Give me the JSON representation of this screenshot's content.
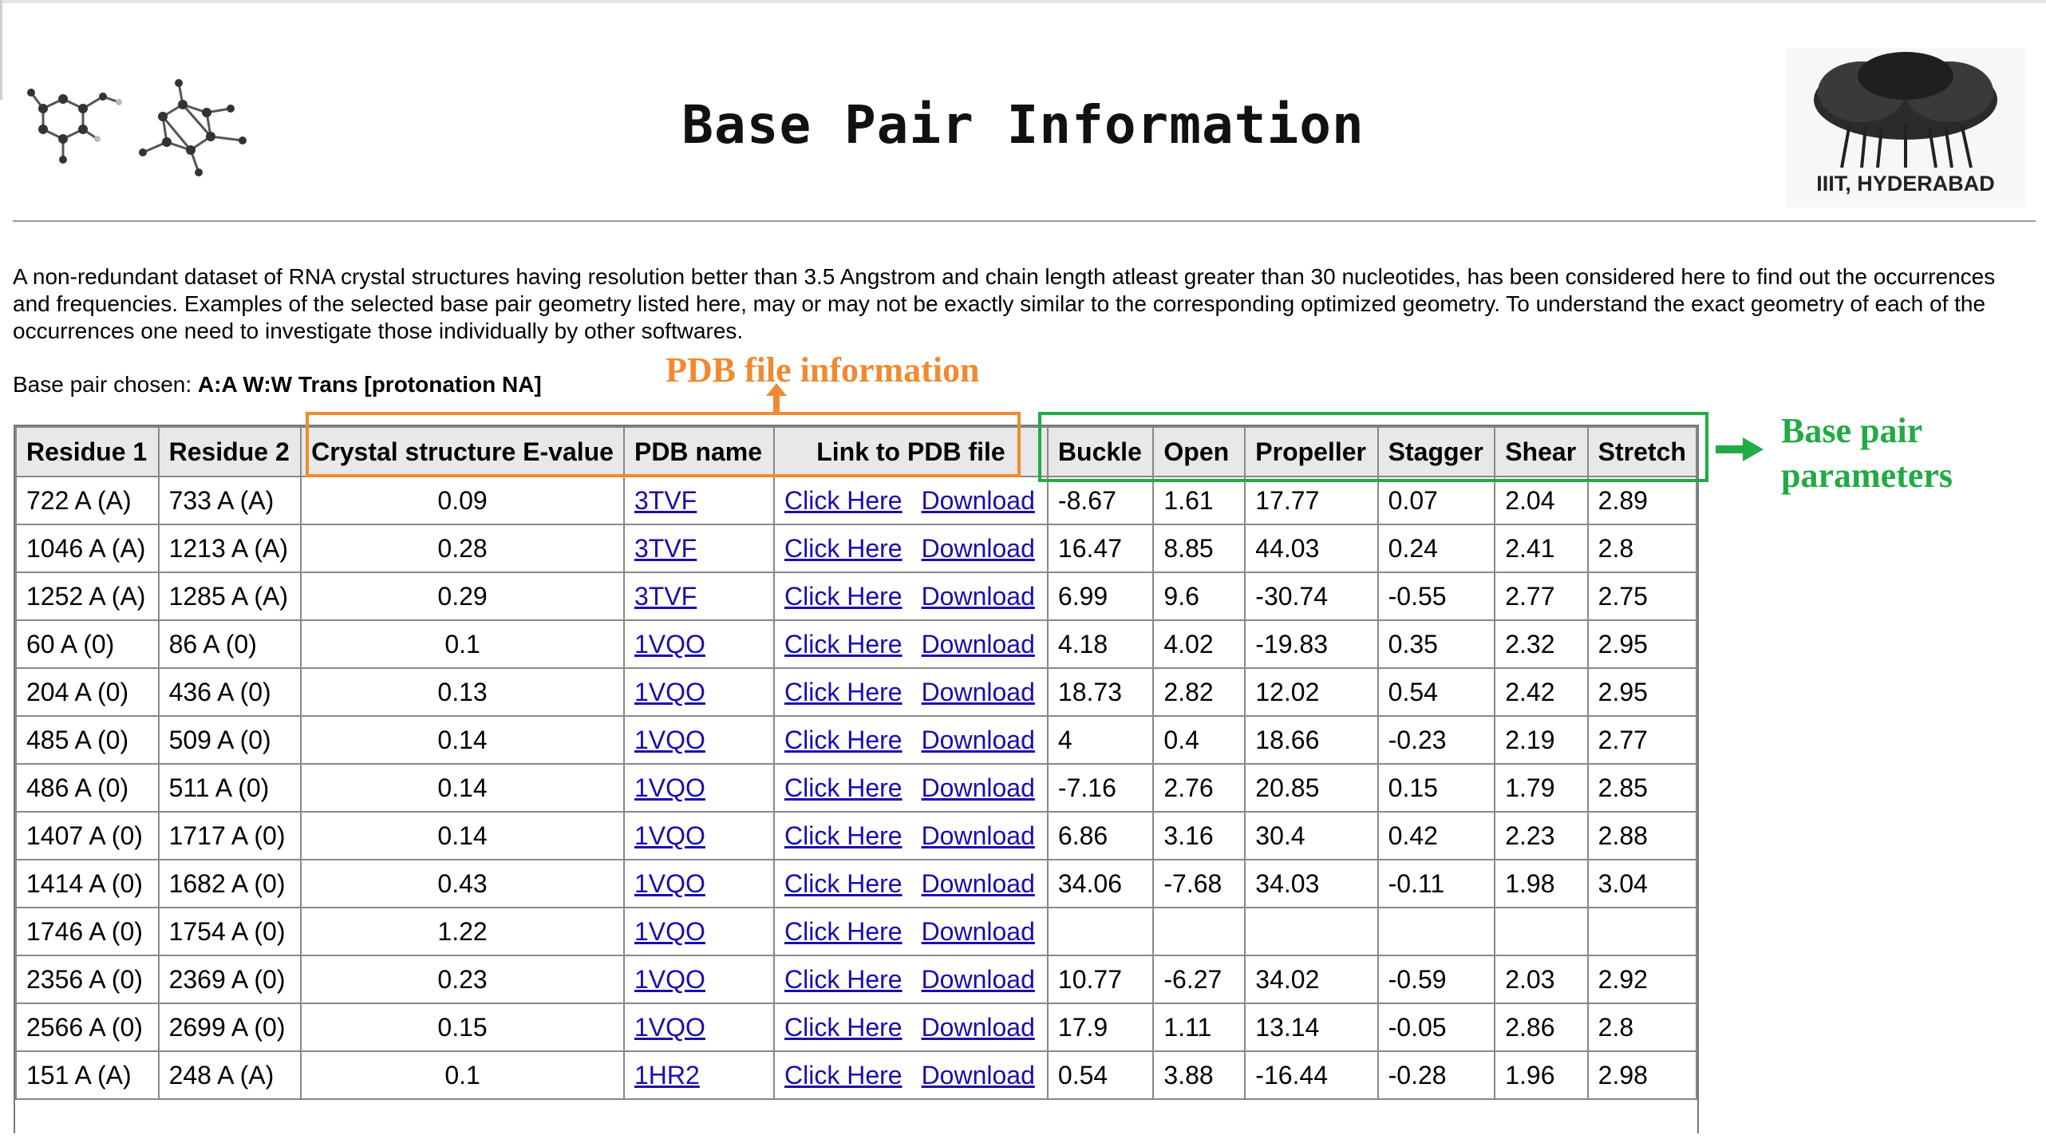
{
  "header": {
    "title": "Base Pair Information",
    "logo_text": "IIIT, HYDERABAD"
  },
  "intro": "A non-redundant dataset of RNA crystal structures having resolution better than 3.5 Angstrom and chain length atleast greater than 30 nucleotides, has been considered here to find out the occurrences and frequencies. Examples of the selected base pair geometry listed here, may or may not be exactly similar to the corresponding optimized geometry. To understand the exact geometry of each of the occurrences one need to investigate those individually by other softwares.",
  "chosen": {
    "label": "Base pair chosen:",
    "value": "A:A W:W Trans [protonation NA]"
  },
  "annotations": {
    "pdb_info": "PDB file information",
    "base_params": "Base pair parameters",
    "colors": {
      "orange": "#f08a30",
      "green": "#22aa44"
    }
  },
  "table": {
    "headers": [
      "Residue 1",
      "Residue 2",
      "Crystal structure E-value",
      "PDB name",
      "Link to PDB file",
      "Buckle",
      "Open",
      "Propeller",
      "Stagger",
      "Shear",
      "Stretch"
    ],
    "link_labels": {
      "click": "Click Here",
      "download": "Download"
    },
    "rows": [
      {
        "r1": "722 A (A)",
        "r2": "733 A (A)",
        "ev": "0.09",
        "pdb": "3TVF",
        "buckle": "-8.67",
        "open": "1.61",
        "propeller": "17.77",
        "stagger": "0.07",
        "shear": "2.04",
        "stretch": "2.89"
      },
      {
        "r1": "1046 A (A)",
        "r2": "1213 A (A)",
        "ev": "0.28",
        "pdb": "3TVF",
        "buckle": "16.47",
        "open": "8.85",
        "propeller": "44.03",
        "stagger": "0.24",
        "shear": "2.41",
        "stretch": "2.8"
      },
      {
        "r1": "1252 A (A)",
        "r2": "1285 A (A)",
        "ev": "0.29",
        "pdb": "3TVF",
        "buckle": "6.99",
        "open": "9.6",
        "propeller": "-30.74",
        "stagger": "-0.55",
        "shear": "2.77",
        "stretch": "2.75"
      },
      {
        "r1": "60 A (0)",
        "r2": "86 A (0)",
        "ev": "0.1",
        "pdb": "1VQO",
        "buckle": "4.18",
        "open": "4.02",
        "propeller": "-19.83",
        "stagger": "0.35",
        "shear": "2.32",
        "stretch": "2.95"
      },
      {
        "r1": "204 A (0)",
        "r2": "436 A (0)",
        "ev": "0.13",
        "pdb": "1VQO",
        "buckle": "18.73",
        "open": "2.82",
        "propeller": "12.02",
        "stagger": "0.54",
        "shear": "2.42",
        "stretch": "2.95"
      },
      {
        "r1": "485 A (0)",
        "r2": "509 A (0)",
        "ev": "0.14",
        "pdb": "1VQO",
        "buckle": "4",
        "open": "0.4",
        "propeller": "18.66",
        "stagger": "-0.23",
        "shear": "2.19",
        "stretch": "2.77"
      },
      {
        "r1": "486 A (0)",
        "r2": "511 A (0)",
        "ev": "0.14",
        "pdb": "1VQO",
        "buckle": "-7.16",
        "open": "2.76",
        "propeller": "20.85",
        "stagger": "0.15",
        "shear": "1.79",
        "stretch": "2.85"
      },
      {
        "r1": "1407 A (0)",
        "r2": "1717 A (0)",
        "ev": "0.14",
        "pdb": "1VQO",
        "buckle": "6.86",
        "open": "3.16",
        "propeller": "30.4",
        "stagger": "0.42",
        "shear": "2.23",
        "stretch": "2.88"
      },
      {
        "r1": "1414 A (0)",
        "r2": "1682 A (0)",
        "ev": "0.43",
        "pdb": "1VQO",
        "buckle": "34.06",
        "open": "-7.68",
        "propeller": "34.03",
        "stagger": "-0.11",
        "shear": "1.98",
        "stretch": "3.04"
      },
      {
        "r1": "1746 A (0)",
        "r2": "1754 A (0)",
        "ev": "1.22",
        "pdb": "1VQO",
        "buckle": "",
        "open": "",
        "propeller": "",
        "stagger": "",
        "shear": "",
        "stretch": ""
      },
      {
        "r1": "2356 A (0)",
        "r2": "2369 A (0)",
        "ev": "0.23",
        "pdb": "1VQO",
        "buckle": "10.77",
        "open": "-6.27",
        "propeller": "34.02",
        "stagger": "-0.59",
        "shear": "2.03",
        "stretch": "2.92"
      },
      {
        "r1": "2566 A (0)",
        "r2": "2699 A (0)",
        "ev": "0.15",
        "pdb": "1VQO",
        "buckle": "17.9",
        "open": "1.11",
        "propeller": "13.14",
        "stagger": "-0.05",
        "shear": "2.86",
        "stretch": "2.8"
      },
      {
        "r1": "151 A (A)",
        "r2": "248 A (A)",
        "ev": "0.1",
        "pdb": "1HR2",
        "buckle": "0.54",
        "open": "3.88",
        "propeller": "-16.44",
        "stagger": "-0.28",
        "shear": "1.96",
        "stretch": "2.98"
      }
    ]
  }
}
